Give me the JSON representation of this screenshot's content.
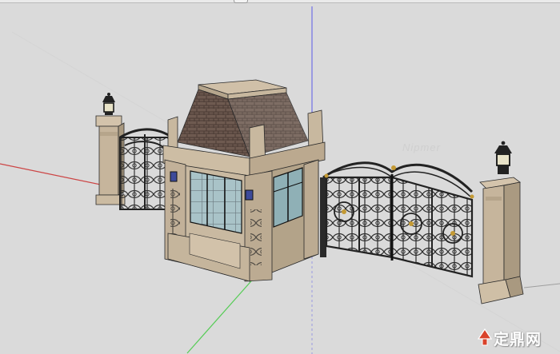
{
  "watermark": {
    "text": "定鼎网",
    "ghost_text": "Nipmer",
    "logo_icon": "tree-logo-icon",
    "logo_color": "#d9422a"
  },
  "colors": {
    "background": "#dadada",
    "stone": "#c9b9a1",
    "roof": "#6f5a50",
    "iron": "#2a2a2a",
    "axis_red": "#c83c3c",
    "axis_green": "#4cc94c",
    "axis_blue": "#6f6fe0"
  },
  "icons": [
    "lantern-icon",
    "wall-lamp-icon",
    "tree-logo-icon"
  ]
}
